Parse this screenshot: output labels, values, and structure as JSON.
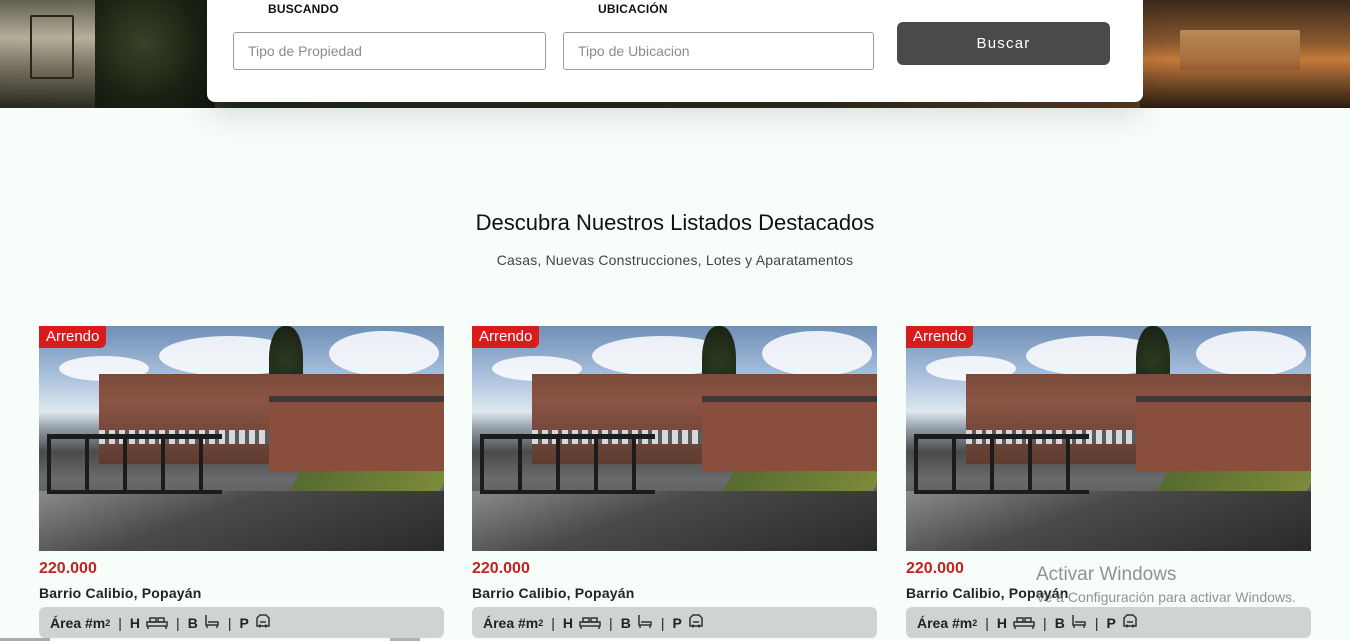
{
  "search": {
    "field1_label": "BUSCANDO",
    "field1_placeholder": "Tipo de Propiedad",
    "field2_label": "UBICACIÓN",
    "field2_placeholder": "Tipo de Ubicacion",
    "button_label": "Buscar"
  },
  "featured": {
    "title": "Descubra Nuestros Listados Destacados",
    "subtitle": "Casas, Nuevas Construcciones, Lotes y Aparatamentos"
  },
  "listings": [
    {
      "badge": "Arrendo",
      "price": "220.000",
      "location": "Barrio Calibio, Popayán",
      "area_label": "Área #m",
      "area_sup": "2",
      "h": "H",
      "b": "B",
      "p": "P",
      "sep": "|"
    },
    {
      "badge": "Arrendo",
      "price": "220.000",
      "location": "Barrio Calibio, Popayán",
      "area_label": "Área #m",
      "area_sup": "2",
      "h": "H",
      "b": "B",
      "p": "P",
      "sep": "|"
    },
    {
      "badge": "Arrendo",
      "price": "220.000",
      "location": "Barrio Calibio, Popayán",
      "area_label": "Área #m",
      "area_sup": "2",
      "h": "H",
      "b": "B",
      "p": "P",
      "sep": "|"
    }
  ],
  "watermark": {
    "title": "Activar Windows",
    "subtitle": "Ve a Configuración para activar Windows."
  },
  "colors": {
    "accent_red": "#d81c1c",
    "price_red": "#c62020",
    "button": "#4a4a4a",
    "features_bg": "#cfd3d1"
  },
  "icons": [
    "bed-icon",
    "bath-icon",
    "parking-icon"
  ]
}
